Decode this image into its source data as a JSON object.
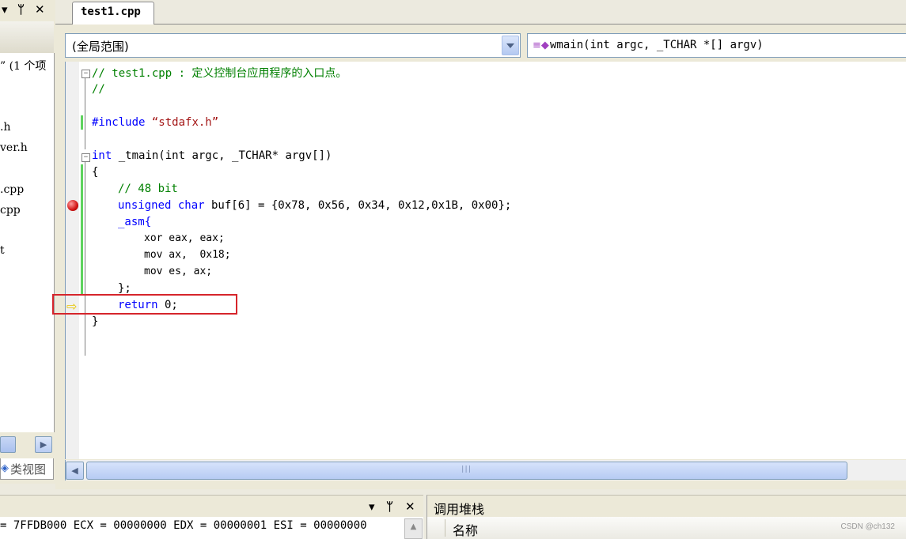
{
  "left_panel": {
    "title_glyphs": [
      "▾",
      "ᛘ",
      "✕"
    ],
    "tree_items": [
      "” (1 个项",
      ".h",
      "ver.h",
      ".cpp",
      "cpp",
      "t"
    ],
    "class_view_tab": "类视图"
  },
  "editor": {
    "tab_title": "test1.cpp",
    "scope_combo": "(全局范围)",
    "function_combo": "wmain(int argc, _TCHAR *[] argv)",
    "code": {
      "l1_comment": "// test1.cpp : 定义控制台应用程序的入口点。",
      "l2_comment": "//",
      "l3_directive": "#include",
      "l3_string": "“stdafx.h”",
      "l4_kw": "int",
      "l4_rest": " _tmain(int argc, _TCHAR* argv[])",
      "l5": "{",
      "l6_comment": "// 48 bit",
      "l7_kw": "unsigned char",
      "l7_rest": " buf[6] = {0x78, 0x56, 0x34, 0x12,0x1B, 0x00};",
      "l8": "_asm{",
      "l9": "xor eax, eax;",
      "l10": "mov ax,  0x18;",
      "l11": "mov es, ax;",
      "l12": "};",
      "l13_kw": "return",
      "l13_rest": " 0;",
      "l14": "}"
    }
  },
  "bottom": {
    "left_title_glyphs": [
      "▾",
      "ᛘ",
      "✕"
    ],
    "registers_line": "= 7FFDB000 ECX = 00000000 EDX = 00000001 ESI = 00000000",
    "callstack_title": "调用堆栈",
    "callstack_col_name": "名称"
  },
  "watermark": "CSDN @ch132",
  "colors": {
    "keyword": "#0000ff",
    "comment": "#008000",
    "breakpoint": "#d21414",
    "exec_arrow": "#e9c700",
    "highlight_box": "#d6252b"
  }
}
